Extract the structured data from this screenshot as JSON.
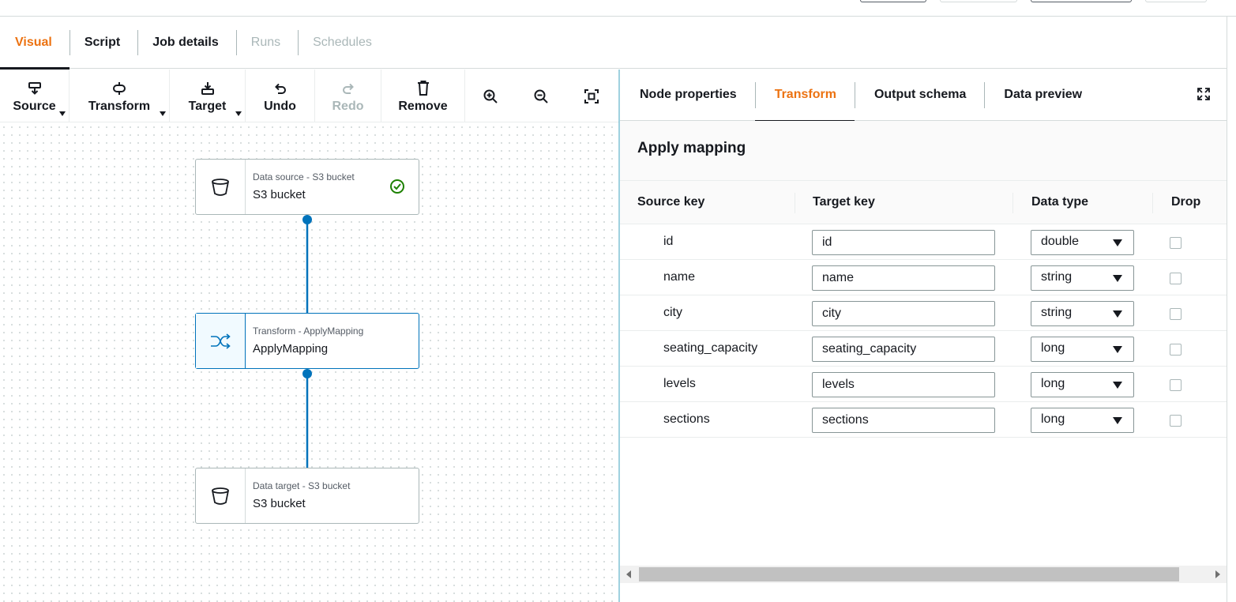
{
  "main_tabs": [
    {
      "label": "Visual",
      "state": "active"
    },
    {
      "label": "Script",
      "state": "normal"
    },
    {
      "label": "Job details",
      "state": "normal"
    },
    {
      "label": "Runs",
      "state": "disabled"
    },
    {
      "label": "Schedules",
      "state": "disabled"
    }
  ],
  "toolbar": {
    "source": {
      "label": "Source",
      "icon": "source-node-icon"
    },
    "transform": {
      "label": "Transform",
      "icon": "transform-node-icon"
    },
    "target": {
      "label": "Target",
      "icon": "target-node-icon"
    },
    "undo": {
      "label": "Undo",
      "icon": "undo-icon"
    },
    "redo": {
      "label": "Redo",
      "icon": "redo-icon",
      "disabled": true
    },
    "remove": {
      "label": "Remove",
      "icon": "trash-icon"
    },
    "zoom_in": {
      "icon": "zoom-in-icon"
    },
    "zoom_out": {
      "icon": "zoom-out-icon"
    },
    "fit": {
      "icon": "fit-to-screen-icon"
    }
  },
  "nodes": [
    {
      "subtitle": "Data source - S3 bucket",
      "title": "S3 bucket",
      "icon": "bucket-icon",
      "status_icon": "check-circle-icon"
    },
    {
      "subtitle": "Transform - ApplyMapping",
      "title": "ApplyMapping",
      "icon": "shuffle-icon"
    },
    {
      "subtitle": "Data target - S3 bucket",
      "title": "S3 bucket",
      "icon": "bucket-icon"
    }
  ],
  "sub_tabs": [
    {
      "label": "Node properties",
      "state": "normal"
    },
    {
      "label": "Transform",
      "state": "active"
    },
    {
      "label": "Output schema",
      "state": "normal"
    },
    {
      "label": "Data preview",
      "state": "normal"
    }
  ],
  "panel": {
    "title": "Apply mapping",
    "columns": {
      "source_key": "Source key",
      "target_key": "Target key",
      "data_type": "Data type",
      "drop": "Drop"
    },
    "rows": [
      {
        "source": "id",
        "target": "id",
        "type": "double",
        "drop": false
      },
      {
        "source": "name",
        "target": "name",
        "type": "string",
        "drop": false
      },
      {
        "source": "city",
        "target": "city",
        "type": "string",
        "drop": false
      },
      {
        "source": "seating_capacity",
        "target": "seating_capacity",
        "type": "long",
        "drop": false
      },
      {
        "source": "levels",
        "target": "levels",
        "type": "long",
        "drop": false
      },
      {
        "source": "sections",
        "target": "sections",
        "type": "long",
        "drop": false
      }
    ]
  },
  "colors": {
    "accent": "#ec7211",
    "link": "#0073bb",
    "success": "#1d8102",
    "text": "#16191f",
    "disabled": "#aab7b8"
  }
}
